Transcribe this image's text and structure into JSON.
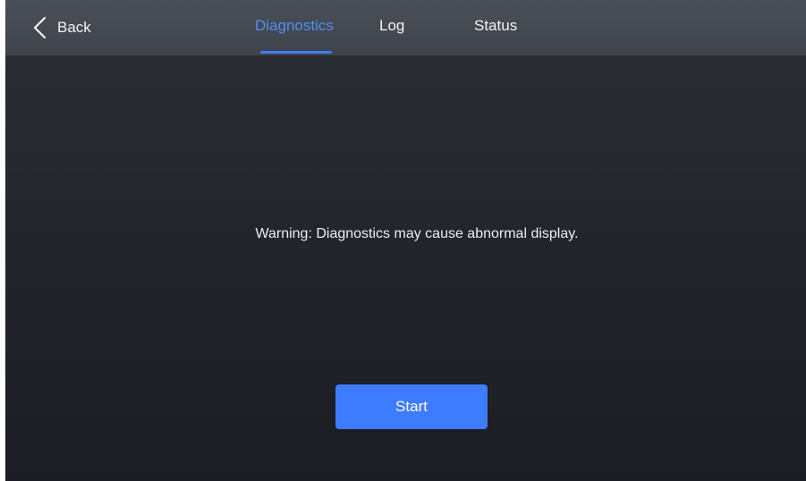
{
  "header": {
    "back_label": "Back",
    "tabs": [
      {
        "label": "Diagnostics",
        "active": true
      },
      {
        "label": "Log",
        "active": false
      },
      {
        "label": "Status",
        "active": false
      }
    ]
  },
  "main": {
    "warning_text": "Warning: Diagnostics may cause abnormal display.",
    "start_label": "Start"
  },
  "colors": {
    "accent": "#3d7bff",
    "active_tab": "#4f8ff7",
    "header_bg": "#454952",
    "body_bg": "#23262c"
  },
  "icons": {
    "back": "chevron-left-icon"
  }
}
